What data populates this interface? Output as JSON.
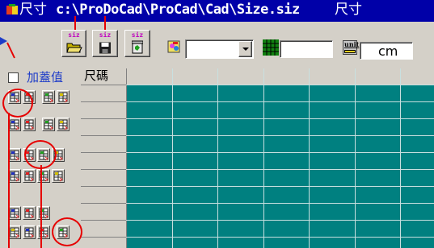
{
  "window": {
    "title_prefix": "尺寸",
    "file_path": "c:\\ProDoCad\\ProCad\\Cad\\Size.siz",
    "title_suffix": "尺寸"
  },
  "toolbar": {
    "open_label": "siz",
    "save_label": "siz",
    "delete_label": "siz",
    "unit_label": "unit",
    "unit_value": "cm",
    "dropdown_value": "",
    "text_value": ""
  },
  "options": {
    "add_tolerance_label": "加蓋值",
    "add_tolerance_checked": false
  },
  "grid": {
    "header_label": "尺碼",
    "columns": 7,
    "rows": 10,
    "cell_color": "#008080"
  },
  "annotation_color": "#e60000"
}
